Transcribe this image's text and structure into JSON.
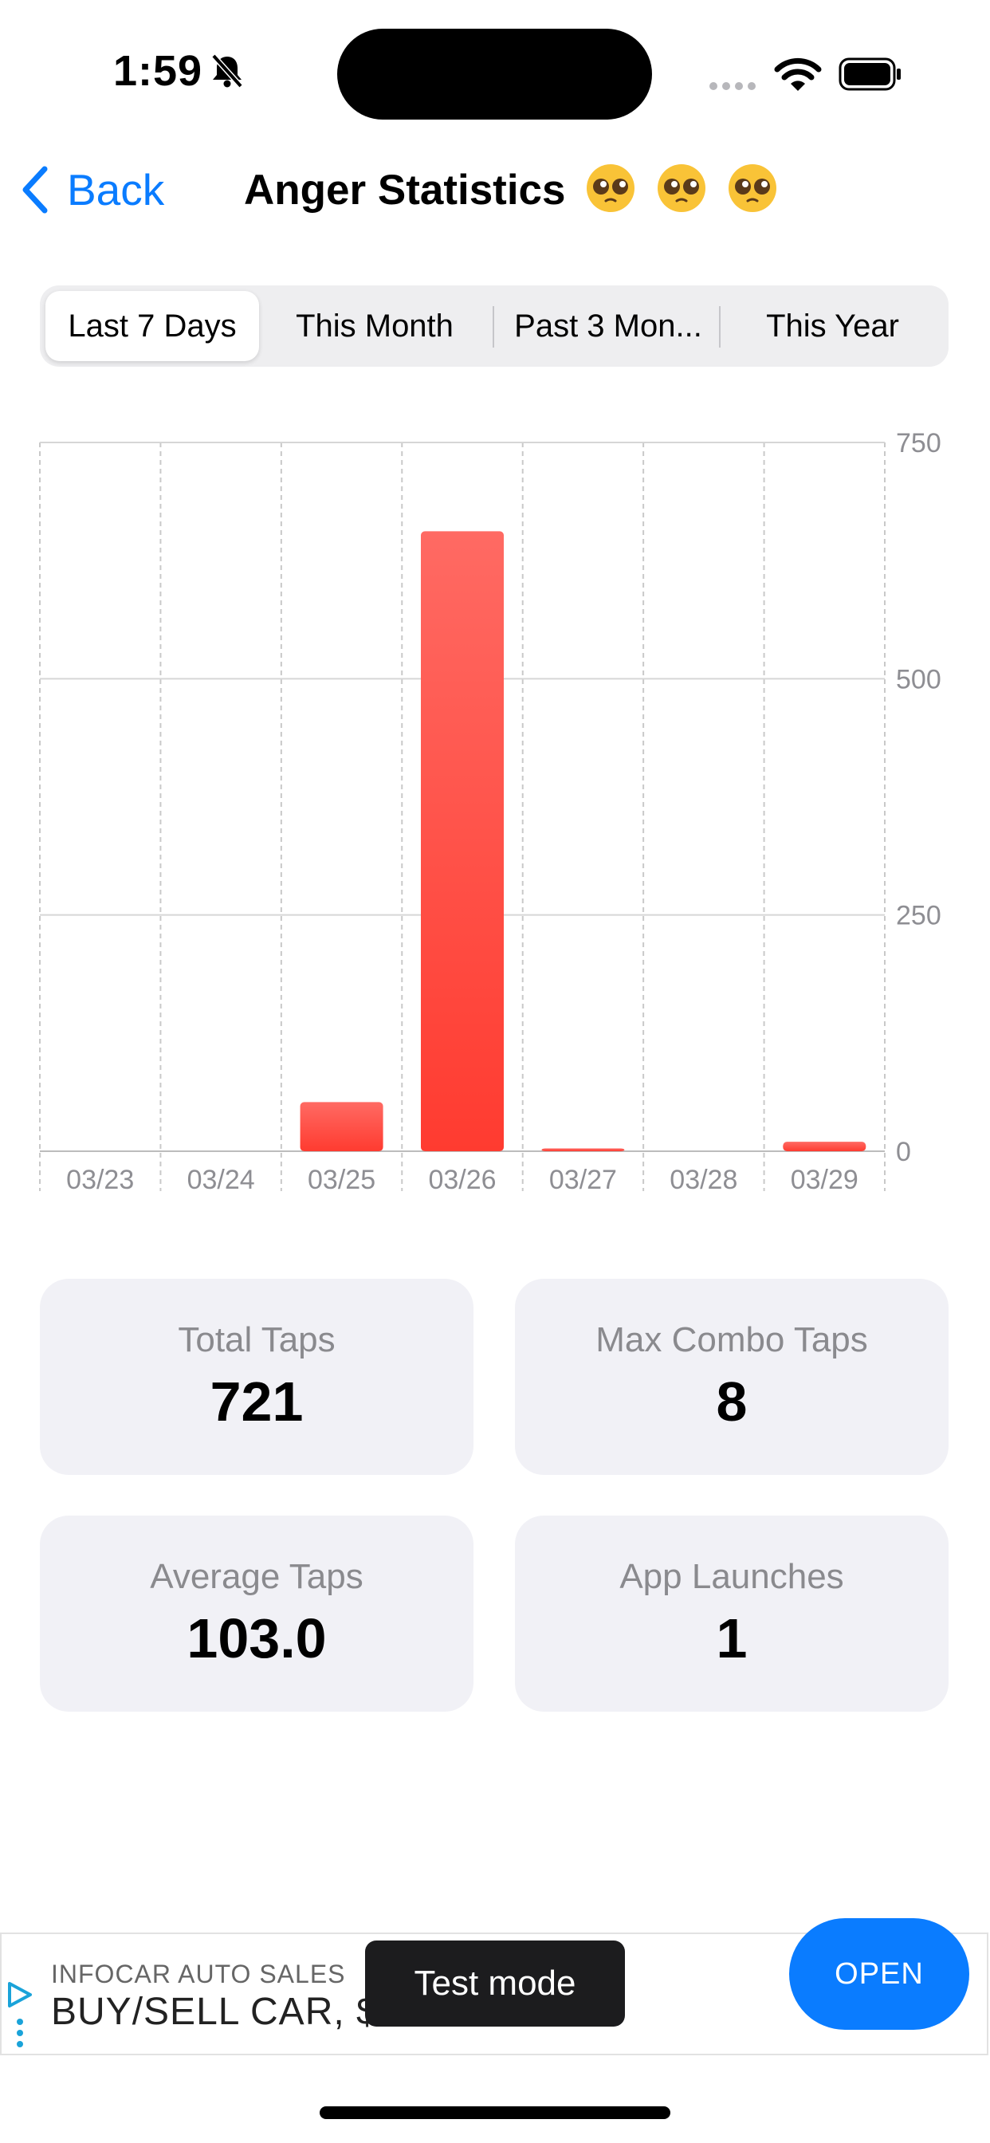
{
  "status_bar": {
    "time": "1:59"
  },
  "nav": {
    "back_label": "Back",
    "title": "Anger Statistics"
  },
  "segments": [
    "Last 7 Days",
    "This Month",
    "Past 3 Mon...",
    "This Year"
  ],
  "selected_segment": "Last 7 Days",
  "chart_data": {
    "type": "bar",
    "categories": [
      "03/23",
      "03/24",
      "03/25",
      "03/26",
      "03/27",
      "03/28",
      "03/29"
    ],
    "values": [
      0,
      0,
      52,
      656,
      3,
      0,
      10
    ],
    "ylim": [
      0,
      750
    ],
    "yticks": [
      "750",
      "500",
      "250",
      "0"
    ],
    "ytick_values": [
      750,
      500,
      250,
      0
    ],
    "color": "#ff3b30",
    "color_light": "#ff6a63",
    "grid": true,
    "y_axis_position": "right"
  },
  "stats": [
    {
      "label": "Total Taps",
      "value": "721"
    },
    {
      "label": "Max Combo Taps",
      "value": "8"
    },
    {
      "label": "Average Taps",
      "value": "103.0"
    },
    {
      "label": "App Launches",
      "value": "1"
    }
  ],
  "ad": {
    "advertiser": "INFOCAR AUTO SALES",
    "headline": "BUY/SELL CAR, $0",
    "cta": "OPEN",
    "toast": "Test mode"
  },
  "colors": {
    "accent": "#0a7cff",
    "card_bg": "#f1f1f6",
    "bar": "#ff3b30"
  }
}
